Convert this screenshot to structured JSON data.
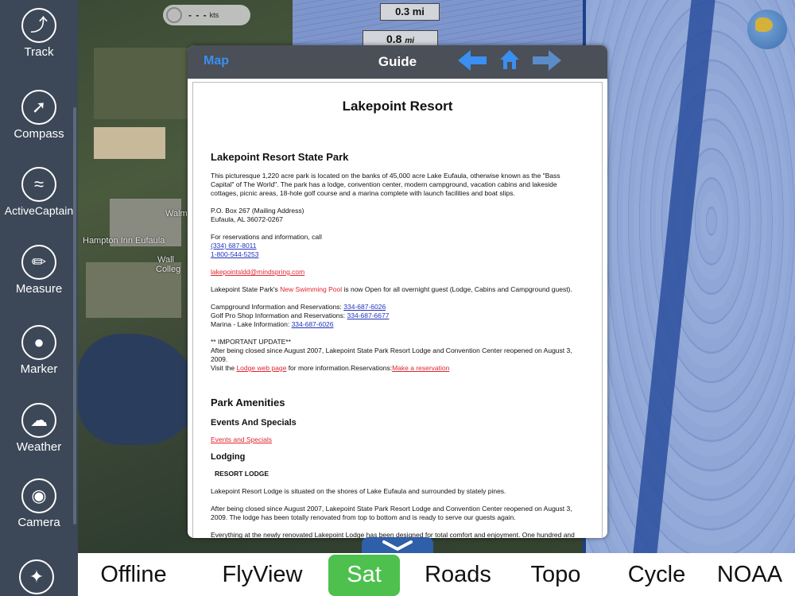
{
  "sidebar": {
    "items": [
      {
        "label": "Track",
        "icon": "track-icon"
      },
      {
        "label": "Compass",
        "icon": "compass-icon"
      },
      {
        "label": "ActiveCaptain",
        "icon": "activecaptain-icon"
      },
      {
        "label": "Measure",
        "icon": "ruler-icon"
      },
      {
        "label": "Marker",
        "icon": "map-pin-icon"
      },
      {
        "label": "Weather",
        "icon": "cloud-rain-icon"
      },
      {
        "label": "Camera",
        "icon": "camera-icon"
      }
    ],
    "bottom_icon": "satellite-icon"
  },
  "map": {
    "speed_value": "- - -",
    "speed_unit": "kts",
    "scale_top": "0.3 mi",
    "scale_bottom_value": "0.8",
    "scale_bottom_unit": "mi",
    "labels": {
      "walmart": "Walma",
      "hampton": "Hampton Inn Eufaula",
      "wallace_1": "Wall",
      "wallace_2": "Colleg"
    },
    "colors": {
      "water": "#8fa6d6",
      "channel": "#2b4f9e",
      "land": "#3b4a35"
    }
  },
  "guide": {
    "back_label": "Map",
    "title": "Guide",
    "doc": {
      "title": "Lakepoint Resort",
      "section1_heading": "Lakepoint Resort State Park",
      "intro": "This picturesque 1,220 acre park is located on the banks of 45,000 acre Lake Eufaula, otherwise known as the \"Bass Capital\" of The World\". The park has a lodge, convention center, modern campground, vacation cabins and lakeside cottages, picnic areas, 18-hole golf course and a marina complete with launch facilities and boat slips.",
      "address_1": "P.O. Box 267 (Mailing Address)",
      "address_2": "Eufaula, AL 36072-0267",
      "reservations_intro": "For reservations and information, call",
      "phone_1": "(334) 687-8011",
      "phone_2": "1-800-544-5253",
      "email": "lakepointsldd@mindspring.com",
      "pool_prefix": "Lakepoint State Park's ",
      "pool_link": "New Swimming Pool",
      "pool_suffix": " is now Open for all overnight guest (Lodge, Cabins and Campground guest).",
      "campground_label": "Campground Information and Reservations: ",
      "campground_phone": "334-687-6026",
      "golf_label": "Golf Pro Shop Information and Reservations: ",
      "golf_phone": "334-687-6677",
      "marina_label": "Marina - Lake Information: ",
      "marina_phone": "334-687-6026",
      "update_heading": "** IMPORTANT UPDATE**",
      "update_text": "After being closed since August 2007, Lakepoint State Park Resort Lodge and Convention Center  reopened on August 3, 2009.",
      "visit_prefix": "Visit the ",
      "lodge_link": "Lodge web page",
      "visit_middle": " for more information.Reservations:",
      "reservation_link": "Make a reservation",
      "amenities_heading": "Park Amenities",
      "events_heading": "Events And Specials",
      "events_link": "Events and Specials",
      "lodging_heading": "Lodging",
      "resort_lodge_heading": "RESORT LODGE",
      "lodge_text_1": "Lakepoint Resort Lodge is situated on the shores of Lake Eufaula and surrounded by stately pines.",
      "lodge_text_2": "After being closed since August 2007, Lakepoint State Park Resort Lodge and Convention Center reopened on August 3, 2009.  The lodge has been totally renovated from top to bottom and is ready to serve our guests again.",
      "lodge_text_3": "Everything at the newly renovated Lakepoint Lodge has been designed for total comfort and enjoyment.  One hundred and"
    }
  },
  "tabs": [
    {
      "label": "Offline",
      "active": false
    },
    {
      "label": "FlyView",
      "active": false
    },
    {
      "label": "Sat",
      "active": true
    },
    {
      "label": "Roads",
      "active": false
    },
    {
      "label": "Topo",
      "active": false
    },
    {
      "label": "Cycle",
      "active": false
    },
    {
      "label": "NOAA",
      "active": false
    }
  ],
  "accent_colors": {
    "active_tab": "#4ec04e",
    "link": "#3a8ff0",
    "sidebar": "#3c4858"
  }
}
